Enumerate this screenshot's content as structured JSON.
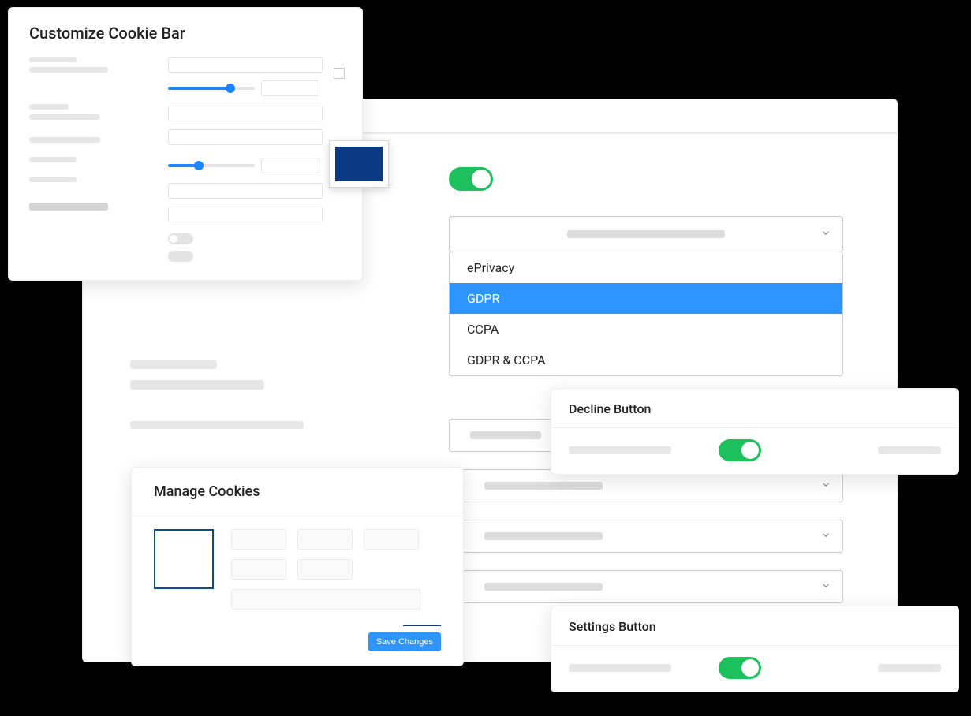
{
  "customize": {
    "title": "Customize Cookie Bar",
    "slider1_percent": 72,
    "slider2_percent": 35,
    "swatch_color": "#0a3a84"
  },
  "main": {
    "toggle_on": true,
    "dropdown_options": [
      "ePrivacy",
      "GDPR",
      "CCPA",
      "GDPR & CCPA"
    ],
    "dropdown_selected_index": 1
  },
  "decline": {
    "title": "Decline Button",
    "toggle_on": true
  },
  "settings": {
    "title": "Settings Button",
    "toggle_on": true
  },
  "manage": {
    "title": "Manage Cookies",
    "save_label": "Save Changes"
  }
}
